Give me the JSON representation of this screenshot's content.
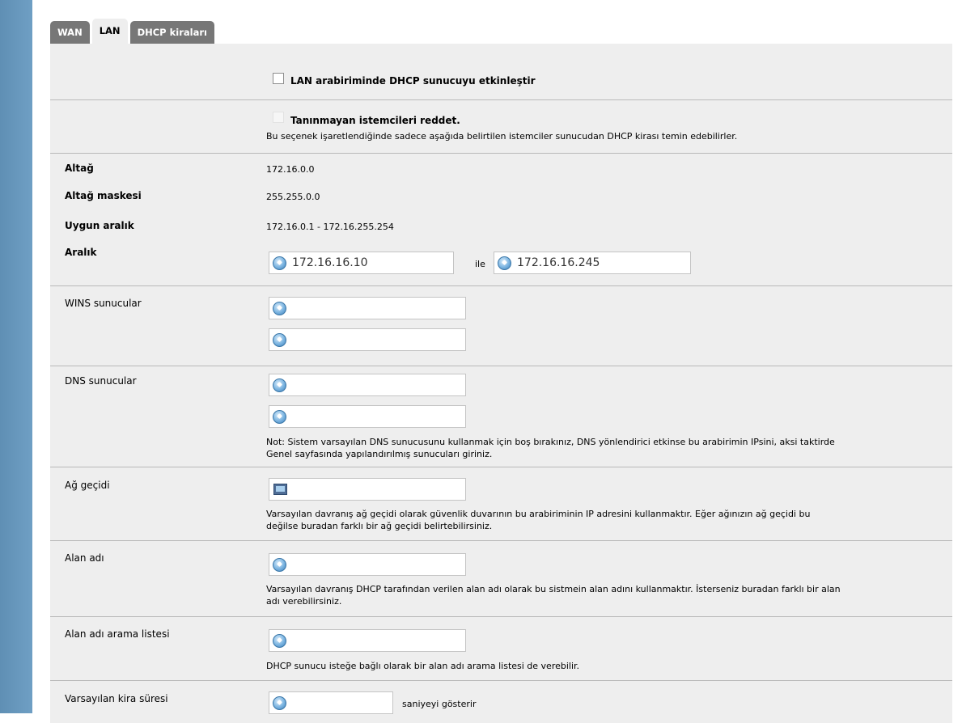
{
  "tabs": [
    {
      "label": "WAN",
      "active": false
    },
    {
      "label": "LAN",
      "active": true
    },
    {
      "label": "DHCP kiraları",
      "active": false
    }
  ],
  "form": {
    "enable_dhcp": {
      "label": "LAN arabiriminde DHCP sunucuyu etkinleştir",
      "checked": false
    },
    "deny_unknown": {
      "label": "Tanınmayan istemcileri reddet.",
      "checked": false,
      "help": "Bu seçenek işaretlendiğinde sadece aşağıda belirtilen istemciler sunucudan DHCP kirası temin edebilirler."
    },
    "subnet": {
      "label": "Altağ",
      "value": "172.16.0.0"
    },
    "subnet_mask": {
      "label": "Altağ maskesi",
      "value": "255.255.0.0"
    },
    "available_range": {
      "label": "Uygun aralık",
      "value": "172.16.0.1 - 172.16.255.254"
    },
    "range": {
      "label": "Aralık",
      "from": "172.16.16.10",
      "separator": "ile",
      "to": "172.16.16.245"
    },
    "wins": {
      "label": "WINS sunucular",
      "server1": "",
      "server2": ""
    },
    "dns": {
      "label": "DNS sunucular",
      "server1": "",
      "server2": "",
      "help_line1": "Not: Sistem varsayılan DNS sunucusunu kullanmak için boş bırakınız, DNS yönlendirici etkinse bu arabirimin IPsini, aksi taktirde",
      "help_line2": "Genel sayfasında yapılandırılmış sunucuları giriniz."
    },
    "gateway": {
      "label": "Ağ geçidi",
      "value": "",
      "help_line1": "Varsayılan davranış ağ geçidi olarak güvenlik duvarının bu arabiriminin IP adresini kullanmaktır. Eğer ağınızın ağ geçidi bu",
      "help_line2": "değilse buradan farklı bir ağ geçidi belirtebilirsiniz."
    },
    "domain": {
      "label": "Alan adı",
      "value": "",
      "help_line1": "Varsayılan davranış DHCP tarafından verilen alan adı olarak bu sistmein alan adını kullanmaktır. İsterseniz buradan farklı bir alan",
      "help_line2": "adı verebilirsiniz."
    },
    "domain_search": {
      "label": "Alan adı arama listesi",
      "value": "",
      "help": "DHCP sunucu isteğe bağlı olarak bir alan adı arama listesi de verebilir."
    },
    "default_lease": {
      "label": "Varsayılan kira süresi",
      "value": "",
      "unit": "saniyeyi gösterir"
    }
  },
  "colors": {
    "panel_bg": "#eeeeee",
    "tab_inactive": "#777777",
    "side_stripe": "#6f9fc4"
  }
}
